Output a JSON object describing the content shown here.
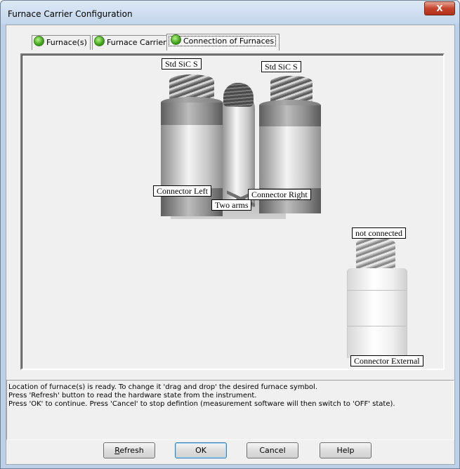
{
  "window": {
    "title": "Furnace Carrier Configuration",
    "close_label": "X"
  },
  "tabs": [
    {
      "label": "Furnace(s)",
      "icon": "green-status-dot"
    },
    {
      "label": "Furnace Carrier",
      "icon": "green-status-dot"
    },
    {
      "label": "Connection of Furnaces",
      "icon": "green-status-dot",
      "active": true
    }
  ],
  "diagram": {
    "left_furnace_label": "Std SiC S",
    "right_furnace_label": "Std SiC S",
    "connector_left": "Connector Left",
    "connector_right": "Connector Right",
    "two_arms": "Two arms",
    "external_furnace_label": "not connected",
    "connector_external": "Connector External"
  },
  "messages": [
    "Location of furnace(s)  is ready. To change it 'drag and drop' the desired furnace symbol.",
    "Press 'Refresh' button to read the hardware state from the instrument.",
    "Press 'OK' to continue. Press 'Cancel' to stop defintion (measurement  software will then switch to 'OFF' state)."
  ],
  "buttons": {
    "refresh": "Refresh",
    "refresh_rest": "efresh",
    "refresh_mnemonic": "R",
    "ok": "OK",
    "cancel": "Cancel",
    "help": "Help"
  },
  "colors": {
    "titlebar": "#c3d6ec",
    "close_button": "#c4442c",
    "status_dot": "#3fa31a"
  }
}
